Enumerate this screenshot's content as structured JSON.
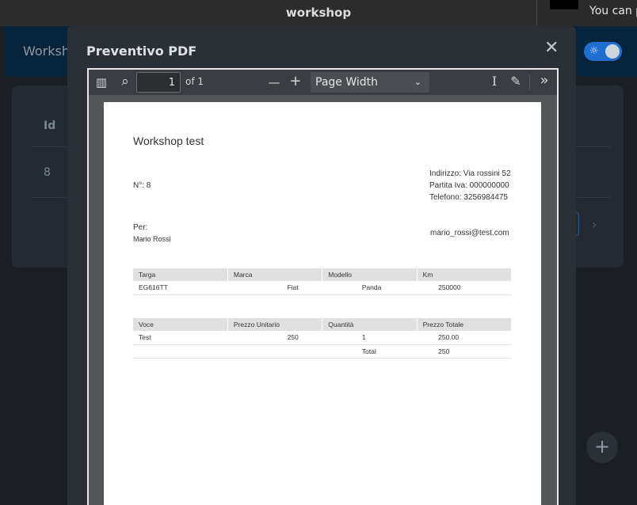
{
  "os": {
    "window_title": "workshop",
    "notification_text": "You can p"
  },
  "app": {
    "header_title": "Worksho",
    "table": {
      "header_id": "Id",
      "row_id": "8"
    },
    "pagination_next": "›",
    "fab_label": "+"
  },
  "dialog": {
    "title": "Preventivo PDF",
    "close": "✕",
    "toolbar": {
      "sidebar_icon": "▥",
      "search_icon": "⌕",
      "page_number": "1",
      "of_pages": "of 1",
      "zoom_out": "—",
      "zoom_in": "+",
      "zoom_value": "Page Width",
      "zoom_chevron": "⌄",
      "text_select_icon": "I",
      "draw_icon": "✎",
      "more_icon": "»"
    },
    "pdf": {
      "title": "Workshop test",
      "number": "N°: 8",
      "address": "Indirizzo: Via rossini 52",
      "vat": "Partita Iva: 000000000",
      "phone": "Telefono: 3256984475",
      "per": "Per:",
      "customer": "Mario Rossi",
      "email": "mario_rossi@test.com",
      "vehicle_headers": [
        "Targa",
        "Marca",
        "Modello",
        "Km"
      ],
      "vehicle_row": [
        "EG616TT",
        "Fiat",
        "Panda",
        "250000"
      ],
      "items_headers": [
        "Voce",
        "Prezzo Unitario",
        "Quantità",
        "Prezzo Totale"
      ],
      "items_row": [
        "Test",
        "250",
        "1",
        "250.00"
      ],
      "total_label": "Total",
      "total_value": "250"
    }
  }
}
